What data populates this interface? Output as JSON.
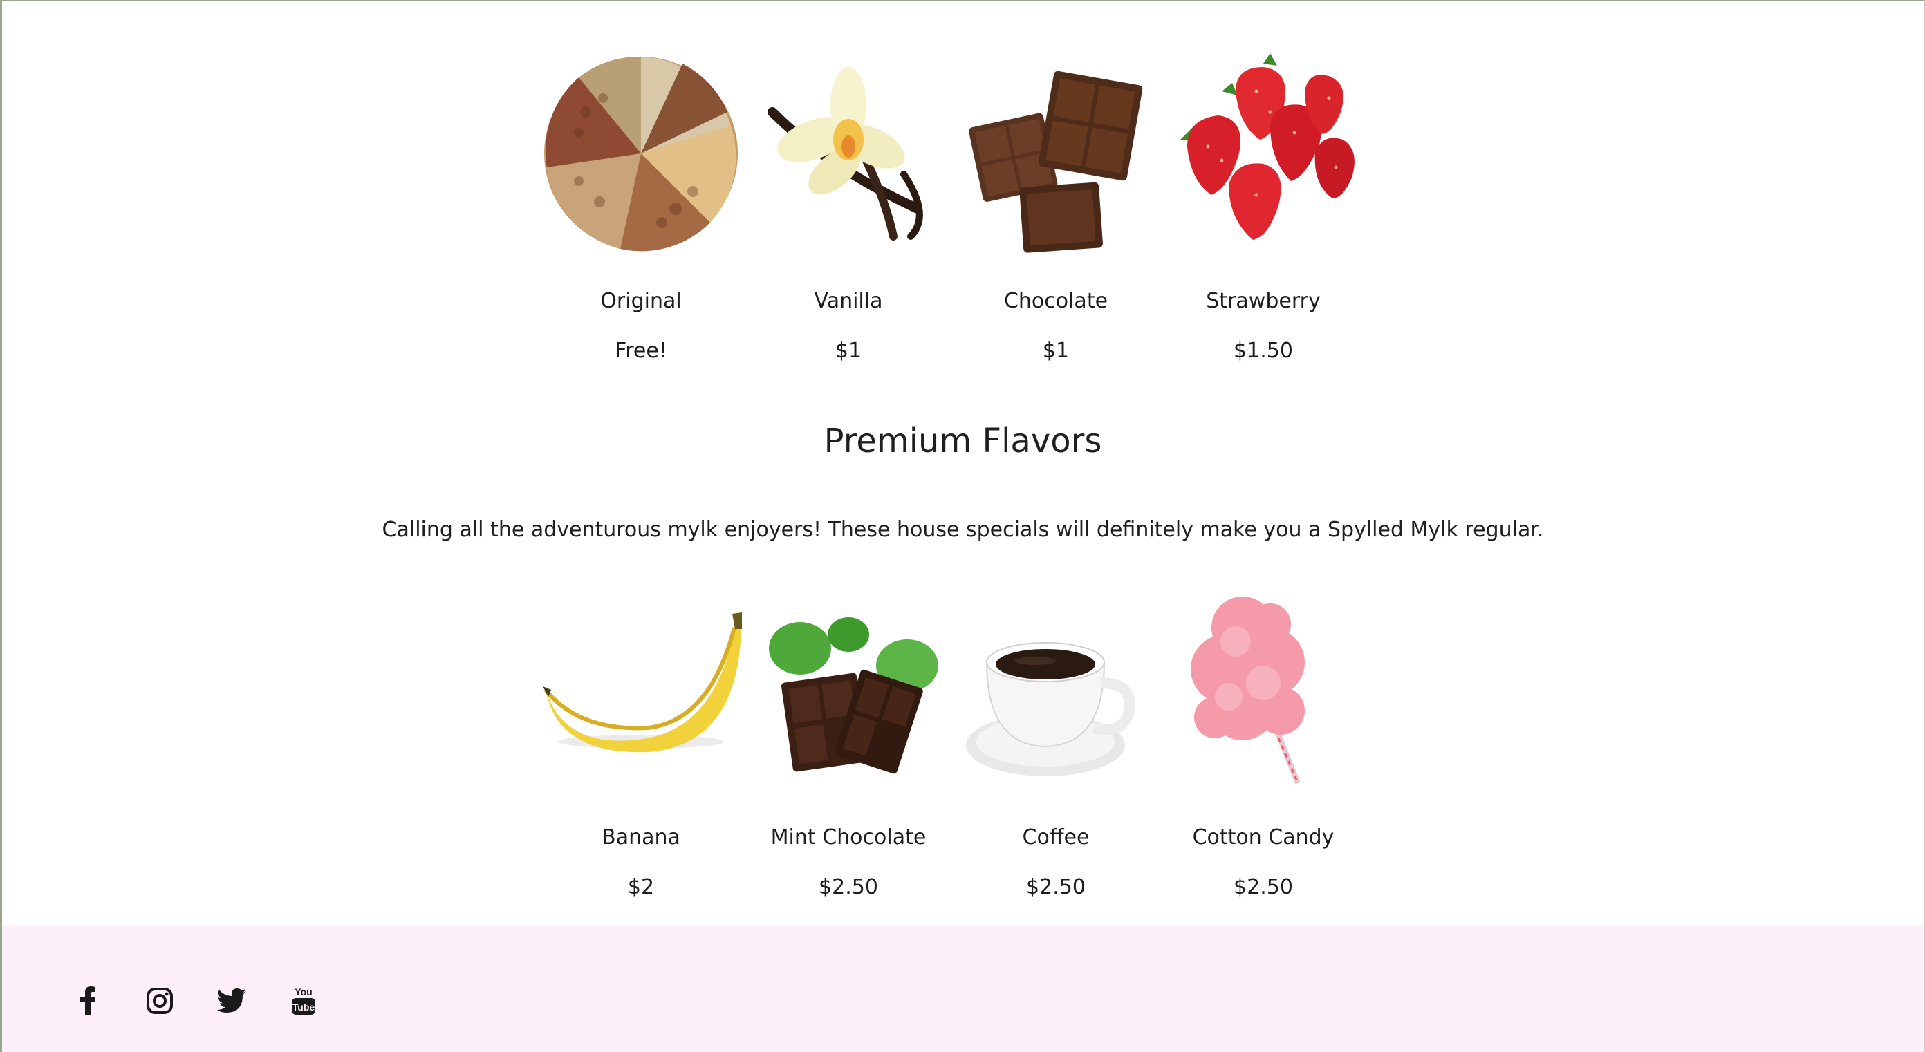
{
  "standard": {
    "flavors": [
      {
        "name": "Original",
        "price": "Free!",
        "image_icon": "mixed-nuts-image"
      },
      {
        "name": "Vanilla",
        "price": "$1",
        "image_icon": "vanilla-flower-image"
      },
      {
        "name": "Chocolate",
        "price": "$1",
        "image_icon": "chocolate-pieces-image"
      },
      {
        "name": "Strawberry",
        "price": "$1.50",
        "image_icon": "strawberries-image"
      }
    ]
  },
  "premium": {
    "title": "Premium Flavors",
    "description": "Calling all the adventurous mylk enjoyers! These house specials will definitely make you a Spylled Mylk regular.",
    "flavors": [
      {
        "name": "Banana",
        "price": "$2",
        "image_icon": "banana-image"
      },
      {
        "name": "Mint Chocolate",
        "price": "$2.50",
        "image_icon": "mint-chocolate-image"
      },
      {
        "name": "Coffee",
        "price": "$2.50",
        "image_icon": "coffee-cup-image"
      },
      {
        "name": "Cotton Candy",
        "price": "$2.50",
        "image_icon": "cotton-candy-image"
      }
    ]
  },
  "footer": {
    "social": [
      "facebook-icon",
      "instagram-icon",
      "twitter-icon",
      "youtube-icon"
    ]
  },
  "colors": {
    "footer_bg": "#fdf0fa",
    "text": "#1d1d1d"
  }
}
